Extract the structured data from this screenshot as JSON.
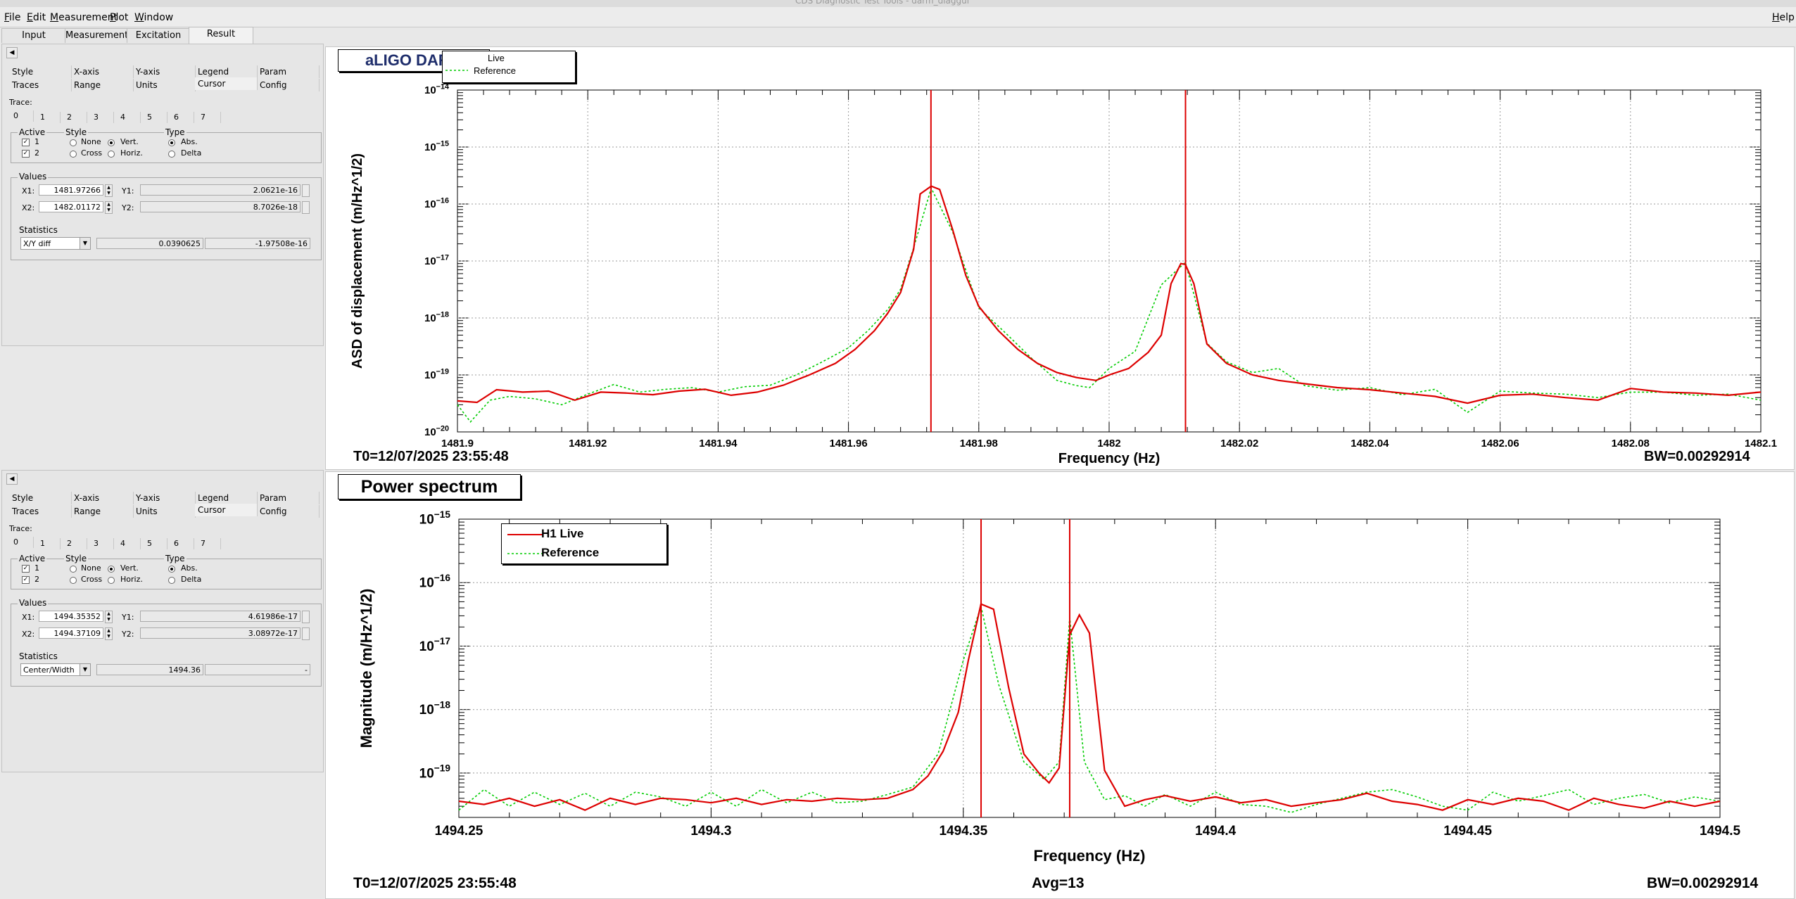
{
  "window": {
    "title": "CDS Diagnostic Test Tools - darm_diaggui",
    "help_label": "Help"
  },
  "menu": {
    "items": [
      "File",
      "Edit",
      "Measurement",
      "Plot",
      "Window"
    ]
  },
  "tabs": {
    "items": [
      "Input",
      "Measurement",
      "Excitation",
      "Result"
    ],
    "active": "Result"
  },
  "control_panels": [
    {
      "option_tabs_row1": [
        "Style",
        "X-axis",
        "Y-axis",
        "Legend",
        "Param"
      ],
      "option_tabs_row2": [
        "Traces",
        "Range",
        "Units",
        "Cursor",
        "Config"
      ],
      "trace_label": "Trace:",
      "trace_tabs": [
        "0",
        "1",
        "2",
        "3",
        "4",
        "5",
        "6",
        "7"
      ],
      "active_label": "Active",
      "active_items": [
        "1",
        "2"
      ],
      "style_label": "Style",
      "style_options": [
        "None",
        "Cross",
        "Vert.",
        "Horiz."
      ],
      "type_label": "Type",
      "type_options": [
        "Abs.",
        "Delta"
      ],
      "values_label": "Values",
      "x1_label": "X1:",
      "x1": "1481.97266",
      "y1_label": "Y1:",
      "y1": "2.0621e-16",
      "x2_label": "X2:",
      "x2": "1482.01172",
      "y2_label": "Y2:",
      "y2": "8.7026e-18",
      "statistics_label": "Statistics",
      "stat_mode": "X/Y diff",
      "stat_value1": "0.0390625",
      "stat_value2": "-1.97508e-16"
    },
    {
      "option_tabs_row1": [
        "Style",
        "X-axis",
        "Y-axis",
        "Legend",
        "Param"
      ],
      "option_tabs_row2": [
        "Traces",
        "Range",
        "Units",
        "Cursor",
        "Config"
      ],
      "trace_label": "Trace:",
      "trace_tabs": [
        "0",
        "1",
        "2",
        "3",
        "4",
        "5",
        "6",
        "7"
      ],
      "active_label": "Active",
      "active_items": [
        "1",
        "2"
      ],
      "style_label": "Style",
      "style_options": [
        "None",
        "Cross",
        "Vert.",
        "Horiz."
      ],
      "type_label": "Type",
      "type_options": [
        "Abs.",
        "Delta"
      ],
      "values_label": "Values",
      "x1_label": "X1:",
      "x1": "1494.35352",
      "y1_label": "Y1:",
      "y1": "4.61986e-17",
      "x2_label": "X2:",
      "x2": "1494.37109",
      "y2_label": "Y2:",
      "y2": "3.08972e-17",
      "statistics_label": "Statistics",
      "stat_mode": "Center/Width",
      "stat_value1": "1494.36",
      "stat_value2": "-"
    }
  ],
  "plots": [
    {
      "title": "aLIGO DARM",
      "legend": [
        "Live",
        "Reference"
      ],
      "t0": "T0=12/07/2025 23:55:48",
      "avg": "",
      "bw": "BW=0.00292914"
    },
    {
      "title": "Power spectrum",
      "legend": [
        "H1 Live",
        "Reference"
      ],
      "t0": "T0=12/07/2025 23:55:48",
      "avg": "Avg=13",
      "bw": "BW=0.00292914"
    }
  ],
  "colors": {
    "live": "#dd0000",
    "reference": "#00cc00",
    "cursor": "#dd0000"
  },
  "chart_data": [
    {
      "type": "line",
      "title": "aLIGO DARM",
      "xlabel": "Frequency (Hz)",
      "ylabel": "ASD of displacement (m/Hz^1/2)",
      "xlim": [
        1481.9,
        1482.1
      ],
      "ylim": [
        1e-20,
        1e-14
      ],
      "yscale": "log",
      "grid": true,
      "legend_position": "top-left",
      "x_ticks": [
        "1481.9",
        "1481.92",
        "1481.94",
        "1481.96",
        "1481.98",
        "1482",
        "1482.02",
        "1482.04",
        "1482.06",
        "1482.08",
        "1482.1"
      ],
      "y_ticks": [
        -20,
        -19,
        -18,
        -17,
        -16,
        -15,
        -14
      ],
      "cursors_x": [
        1481.97266,
        1482.01172
      ],
      "series": [
        {
          "name": "Live",
          "x": [
            1481.9,
            1481.903,
            1481.906,
            1481.91,
            1481.914,
            1481.918,
            1481.922,
            1481.926,
            1481.93,
            1481.934,
            1481.938,
            1481.942,
            1481.946,
            1481.95,
            1481.954,
            1481.958,
            1481.961,
            1481.964,
            1481.966,
            1481.968,
            1481.97,
            1481.971,
            1481.9727,
            1481.974,
            1481.976,
            1481.978,
            1481.98,
            1481.983,
            1481.986,
            1481.989,
            1481.992,
            1481.995,
            1481.998,
            1482.0,
            1482.003,
            1482.006,
            1482.008,
            1482.0095,
            1482.011,
            1482.0117,
            1482.013,
            1482.015,
            1482.018,
            1482.022,
            1482.026,
            1482.03,
            1482.035,
            1482.04,
            1482.045,
            1482.05,
            1482.055,
            1482.06,
            1482.065,
            1482.07,
            1482.075,
            1482.08,
            1482.085,
            1482.09,
            1482.095,
            1482.1
          ],
          "y": [
            3.5e-20,
            3.3e-20,
            5.5e-20,
            5e-20,
            5.2e-20,
            3.6e-20,
            5e-20,
            4.8e-20,
            4.5e-20,
            5.2e-20,
            5.6e-20,
            4.4e-20,
            5e-20,
            6.6e-20,
            1e-19,
            1.6e-19,
            2.8e-19,
            6e-19,
            1.2e-18,
            2.8e-18,
            1.6e-17,
            1.5e-16,
            2.06e-16,
            1.8e-16,
            3.5e-17,
            5.6e-18,
            1.6e-18,
            6e-19,
            2.8e-19,
            1.6e-19,
            1.1e-19,
            9e-20,
            8e-20,
            1e-19,
            1.3e-19,
            2.5e-19,
            5e-19,
            4e-18,
            9e-18,
            8.7e-18,
            4e-18,
            3.5e-19,
            1.6e-19,
            1e-19,
            8e-20,
            7e-20,
            6e-20,
            5.5e-20,
            4.8e-20,
            4.2e-20,
            3.2e-20,
            4.4e-20,
            4.6e-20,
            4e-20,
            3.6e-20,
            5.8e-20,
            5e-20,
            4.8e-20,
            4.4e-20,
            5e-20
          ]
        },
        {
          "name": "Reference",
          "x": [
            1481.9,
            1481.902,
            1481.905,
            1481.908,
            1481.912,
            1481.916,
            1481.92,
            1481.924,
            1481.928,
            1481.932,
            1481.936,
            1481.94,
            1481.944,
            1481.948,
            1481.952,
            1481.956,
            1481.96,
            1481.963,
            1481.966,
            1481.968,
            1481.97,
            1481.9727,
            1481.976,
            1481.98,
            1481.984,
            1481.988,
            1481.992,
            1481.995,
            1481.997,
            1482.0,
            1482.004,
            1482.008,
            1482.0117,
            1482.015,
            1482.018,
            1482.022,
            1482.026,
            1482.03,
            1482.035,
            1482.04,
            1482.045,
            1482.05,
            1482.055,
            1482.06,
            1482.065,
            1482.07,
            1482.075,
            1482.08,
            1482.085,
            1482.09,
            1482.095,
            1482.1
          ],
          "y": [
            3e-20,
            1.5e-20,
            3.6e-20,
            4.2e-20,
            3.8e-20,
            3e-20,
            4.6e-20,
            6.8e-20,
            5e-20,
            5.6e-20,
            6e-20,
            5e-20,
            6.2e-20,
            6.6e-20,
            1e-19,
            1.7e-19,
            3e-19,
            6e-19,
            1.4e-18,
            3.2e-18,
            1.7e-17,
            1.9e-16,
            3.2e-17,
            1.5e-18,
            5.6e-19,
            2e-19,
            8e-20,
            6.5e-20,
            6e-20,
            1.3e-19,
            2.6e-19,
            3.8e-18,
            9.5e-18,
            3.6e-19,
            1.7e-19,
            1.1e-19,
            1.3e-19,
            6.5e-20,
            5.4e-20,
            6e-20,
            4.5e-20,
            5.6e-20,
            2.2e-20,
            5.2e-20,
            4.8e-20,
            4.6e-20,
            4e-20,
            5e-20,
            5e-20,
            4.4e-20,
            4.6e-20,
            3.6e-20
          ]
        }
      ]
    },
    {
      "type": "line",
      "title": "Power spectrum",
      "xlabel": "Frequency (Hz)",
      "ylabel": "Magnitude (m/Hz^1/2)",
      "xlim": [
        1494.25,
        1494.5
      ],
      "ylim": [
        2e-20,
        1e-15
      ],
      "yscale": "log",
      "grid": true,
      "legend_position": "top-left",
      "x_ticks": [
        "1494.25",
        "1494.3",
        "1494.35",
        "1494.4",
        "1494.45",
        "1494.5"
      ],
      "y_ticks": [
        -19,
        -18,
        -17,
        -16,
        -15
      ],
      "cursors_x": [
        1494.35352,
        1494.37109
      ],
      "series": [
        {
          "name": "H1 Live",
          "x": [
            1494.25,
            1494.255,
            1494.26,
            1494.265,
            1494.27,
            1494.275,
            1494.28,
            1494.285,
            1494.29,
            1494.295,
            1494.3,
            1494.305,
            1494.31,
            1494.315,
            1494.32,
            1494.325,
            1494.33,
            1494.335,
            1494.34,
            1494.343,
            1494.346,
            1494.349,
            1494.351,
            1494.3535,
            1494.356,
            1494.359,
            1494.362,
            1494.365,
            1494.367,
            1494.369,
            1494.3711,
            1494.373,
            1494.375,
            1494.378,
            1494.382,
            1494.386,
            1494.39,
            1494.395,
            1494.4,
            1494.405,
            1494.41,
            1494.415,
            1494.42,
            1494.425,
            1494.43,
            1494.435,
            1494.44,
            1494.445,
            1494.45,
            1494.455,
            1494.46,
            1494.465,
            1494.47,
            1494.475,
            1494.48,
            1494.485,
            1494.49,
            1494.495,
            1494.5
          ],
          "y": [
            3.6e-20,
            3.2e-20,
            4e-20,
            3e-20,
            3.8e-20,
            2.6e-20,
            4e-20,
            3.2e-20,
            4e-20,
            3.8e-20,
            3.4e-20,
            4e-20,
            3.2e-20,
            3.8e-20,
            3.6e-20,
            4e-20,
            3.8e-20,
            4e-20,
            5.5e-20,
            9e-20,
            2.2e-19,
            9e-19,
            6e-18,
            4.6e-17,
            3.8e-17,
            2.2e-18,
            2e-19,
            1e-19,
            7e-20,
            1.2e-19,
            1.5e-17,
            3.1e-17,
            1.6e-17,
            1.1e-19,
            3e-20,
            3.8e-20,
            4.4e-20,
            3.6e-20,
            4.2e-20,
            3.4e-20,
            3.8e-20,
            3e-20,
            3.4e-20,
            3.8e-20,
            4.8e-20,
            3.6e-20,
            3.2e-20,
            2.6e-20,
            3.8e-20,
            3.2e-20,
            4e-20,
            3.6e-20,
            2.6e-20,
            4e-20,
            3.2e-20,
            2.8e-20,
            3.6e-20,
            3e-20,
            3.6e-20
          ]
        },
        {
          "name": "Reference",
          "x": [
            1494.25,
            1494.255,
            1494.26,
            1494.265,
            1494.27,
            1494.275,
            1494.28,
            1494.285,
            1494.29,
            1494.295,
            1494.3,
            1494.305,
            1494.31,
            1494.315,
            1494.32,
            1494.325,
            1494.33,
            1494.335,
            1494.34,
            1494.345,
            1494.35,
            1494.3535,
            1494.357,
            1494.362,
            1494.366,
            1494.369,
            1494.3711,
            1494.374,
            1494.378,
            1494.382,
            1494.386,
            1494.39,
            1494.395,
            1494.4,
            1494.405,
            1494.41,
            1494.415,
            1494.42,
            1494.425,
            1494.43,
            1494.435,
            1494.44,
            1494.445,
            1494.45,
            1494.455,
            1494.46,
            1494.465,
            1494.47,
            1494.475,
            1494.48,
            1494.485,
            1494.49,
            1494.495,
            1494.5
          ],
          "y": [
            2.6e-20,
            5.5e-20,
            3e-20,
            5e-20,
            3.2e-20,
            4.8e-20,
            3e-20,
            5e-20,
            4.2e-20,
            3e-20,
            5e-20,
            3e-20,
            5.5e-20,
            3.4e-20,
            5e-20,
            3.4e-20,
            3.6e-20,
            4.6e-20,
            6e-20,
            2e-19,
            6e-18,
            4.2e-17,
            2.5e-18,
            1.5e-19,
            8e-20,
            1.5e-19,
            2.8e-17,
            1.5e-19,
            3.8e-20,
            4.4e-20,
            3e-20,
            4.6e-20,
            3e-20,
            5e-20,
            3.2e-20,
            3e-20,
            2.4e-20,
            3.2e-20,
            4e-20,
            5e-20,
            5.5e-20,
            4.2e-20,
            3e-20,
            2.6e-20,
            5e-20,
            3.6e-20,
            4.4e-20,
            5.5e-20,
            3.2e-20,
            4e-20,
            4.6e-20,
            3.4e-20,
            4.2e-20,
            3.6e-20
          ]
        }
      ]
    }
  ]
}
